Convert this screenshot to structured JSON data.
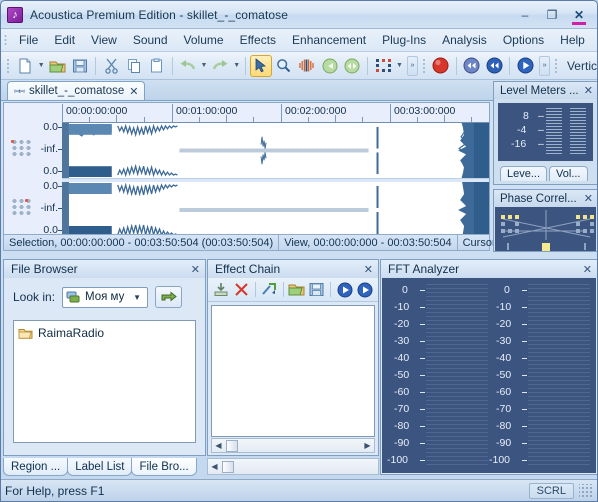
{
  "window": {
    "title": "Acoustica Premium Edition - skillet_-_comatose",
    "app_icon": "music-note-icon",
    "minimize": "–",
    "maximize": "❐",
    "close": "✕"
  },
  "menubar": {
    "items": [
      "File",
      "Edit",
      "View",
      "Sound",
      "Volume",
      "Effects",
      "Enhancement",
      "Plug-Ins",
      "Analysis",
      "Options",
      "Help"
    ]
  },
  "toolbar": {
    "buttons": [
      {
        "name": "new-file-icon",
        "label": "New"
      },
      {
        "name": "new-file-dropdown-icon",
        "label": ""
      },
      {
        "name": "open-file-icon",
        "label": "Open"
      },
      {
        "name": "save-file-icon",
        "label": "Save"
      },
      {
        "name": "cut-icon",
        "label": "Cut"
      },
      {
        "name": "copy-icon",
        "label": "Copy"
      },
      {
        "name": "paste-icon",
        "label": "Paste"
      },
      {
        "name": "undo-icon",
        "label": "Undo"
      },
      {
        "name": "undo-dropdown-icon",
        "label": ""
      },
      {
        "name": "redo-icon",
        "label": "Redo"
      },
      {
        "name": "redo-dropdown-icon",
        "label": ""
      },
      {
        "name": "select-tool-icon",
        "label": "Selection Tool"
      },
      {
        "name": "zoom-tool-icon",
        "label": "Zoom"
      },
      {
        "name": "spectral-tool-icon",
        "label": "Spectral"
      },
      {
        "name": "zoom-out-icon",
        "label": "Zoom Out"
      },
      {
        "name": "zoom-full-icon",
        "label": "Zoom Full"
      },
      {
        "name": "marker-grid-icon",
        "label": "Markers"
      },
      {
        "name": "marker-dropdown-icon",
        "label": ""
      },
      {
        "name": "record-icon",
        "label": "Record"
      },
      {
        "name": "rewind-icon",
        "label": "Rewind"
      },
      {
        "name": "previous-icon",
        "label": "Previous"
      },
      {
        "name": "play-icon",
        "label": "Play"
      }
    ],
    "overflow_label": "»",
    "vertical_label": "Vertic"
  },
  "document_tab": {
    "icon": "waveform-icon",
    "label": "skillet_-_comatose",
    "close": "✕",
    "nav_prev": "◁",
    "nav_next": "▷"
  },
  "editor": {
    "ruler_labels": [
      "00:00:00:000",
      "00:01:00:000",
      "00:02:00:000",
      "00:03:00:000"
    ],
    "channels": [
      {
        "name": "left-channel",
        "axis_top": "0.0",
        "axis_mid": "-inf.",
        "axis_bottom": "0.0"
      },
      {
        "name": "right-channel",
        "axis_top": "0.0",
        "axis_mid": "-inf.",
        "axis_bottom": "0.0"
      }
    ]
  },
  "editor_status": {
    "selection": "Selection, 00:00:00:000 - 00:03:50:504 (00:03:50:504)",
    "view": "View, 00:00:00:000 - 00:03:50:504",
    "cursor": "Cursor,"
  },
  "level_meters": {
    "title": "Level Meters ...",
    "close": "✕",
    "scale": [
      "8",
      "-4",
      "-16"
    ],
    "tabs": [
      "Leve...",
      "Vol..."
    ]
  },
  "phase_correlation": {
    "title": "Phase Correl...",
    "close": "✕"
  },
  "file_browser": {
    "title": "File Browser",
    "close": "✕",
    "look_in_label": "Look in:",
    "look_in_value": "Моя му",
    "combo_icon": "network-computer-icon",
    "combo_arrow": "▼",
    "up_dir_icon": "up-folder-icon",
    "items": [
      {
        "icon": "folder-icon",
        "label": "RaimaRadio"
      }
    ]
  },
  "effect_chain": {
    "title": "Effect Chain",
    "close": "✕",
    "buttons": [
      {
        "name": "add-effect-icon",
        "label": "Add Effect"
      },
      {
        "name": "remove-effect-icon",
        "label": "Remove Effect"
      },
      {
        "name": "reset-chain-icon",
        "label": "Reset Chain"
      },
      {
        "name": "open-chain-icon",
        "label": "Open Chain"
      },
      {
        "name": "save-chain-icon",
        "label": "Save Chain"
      },
      {
        "name": "preview-icon",
        "label": "Preview"
      },
      {
        "name": "apply-icon",
        "label": "Apply"
      }
    ],
    "scroll_left": "◀",
    "scroll_right": "▶"
  },
  "fft_analyzer": {
    "title": "FFT Analyzer",
    "close": "✕",
    "scale": [
      "0",
      "-10",
      "-20",
      "-30",
      "-40",
      "-50",
      "-60",
      "-70",
      "-80",
      "-90",
      "-100"
    ],
    "channels": [
      "left",
      "right"
    ]
  },
  "bottom_tabs": [
    {
      "label": "Region ...",
      "active": false
    },
    {
      "label": "Label List",
      "active": false
    },
    {
      "label": "File Bro...",
      "active": true
    }
  ],
  "bottom_scroll": {
    "left": "◀"
  },
  "statusbar": {
    "hint": "For Help, press F1",
    "scroll_lock": "SCRL"
  },
  "colors": {
    "waveform": "#3d6a99",
    "meter_bg": "#3c5480",
    "accent": "#d21fa8",
    "chrome": "#c3d8ef"
  }
}
